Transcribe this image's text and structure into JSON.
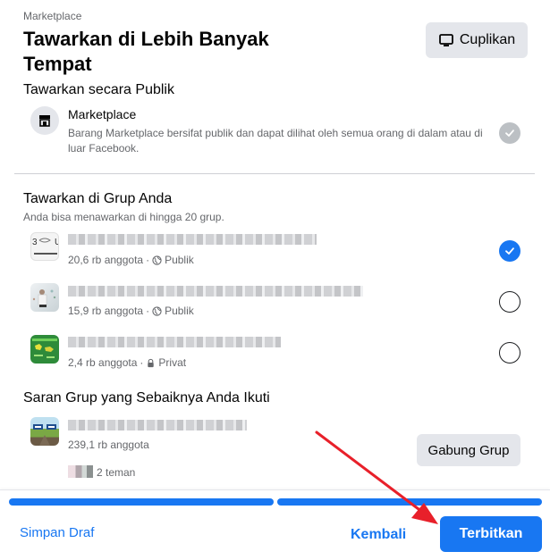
{
  "header": {
    "breadcrumb": "Marketplace",
    "title": "Tawarkan di Lebih Banyak Tempat",
    "preview_button": {
      "label": "Cuplikan",
      "icon": "monitor-icon"
    }
  },
  "public_section": {
    "title": "Tawarkan secara Publik",
    "item": {
      "name": "Marketplace",
      "icon": "storefront-icon",
      "description": "Barang Marketplace bersifat publik dan dapat dilihat oleh semua orang di dalam atau di luar Facebook.",
      "checked": true,
      "locked": true
    }
  },
  "groups_section": {
    "title": "Tawarkan di Grup Anda",
    "subtitle": "Anda bisa menawarkan di hingga 20 grup.",
    "groups": [
      {
        "name_blurred": true,
        "members": "20,6 rb anggota",
        "separator": "·",
        "privacy": "Publik",
        "privacy_icon": "globe-icon",
        "selected": true,
        "avatar_color": "#f2f2f2"
      },
      {
        "name_blurred": true,
        "members": "15,9 rb anggota",
        "separator": "·",
        "privacy": "Publik",
        "privacy_icon": "globe-icon",
        "selected": false,
        "avatar_color": "#d8dde0"
      },
      {
        "name_blurred": true,
        "members": "2,4 rb anggota",
        "separator": "·",
        "privacy": "Privat",
        "privacy_icon": "lock-icon",
        "selected": false,
        "avatar_color": "#2e8b3a"
      }
    ]
  },
  "suggested_section": {
    "title": "Saran Grup yang Sebaiknya Anda Ikuti",
    "group": {
      "name_blurred": true,
      "members": "239,1 rb anggota",
      "friends": "2 teman",
      "join_button": "Gabung Grup"
    }
  },
  "footer": {
    "progress_steps": [
      {
        "complete": true
      },
      {
        "complete": true
      }
    ],
    "save_draft": "Simpan Draf",
    "back": "Kembali",
    "publish": "Terbitkan"
  },
  "colors": {
    "accent": "#1877f2",
    "secondary_button": "#e4e6eb",
    "muted_text": "#65676b",
    "annotation_arrow": "#e8202a"
  }
}
